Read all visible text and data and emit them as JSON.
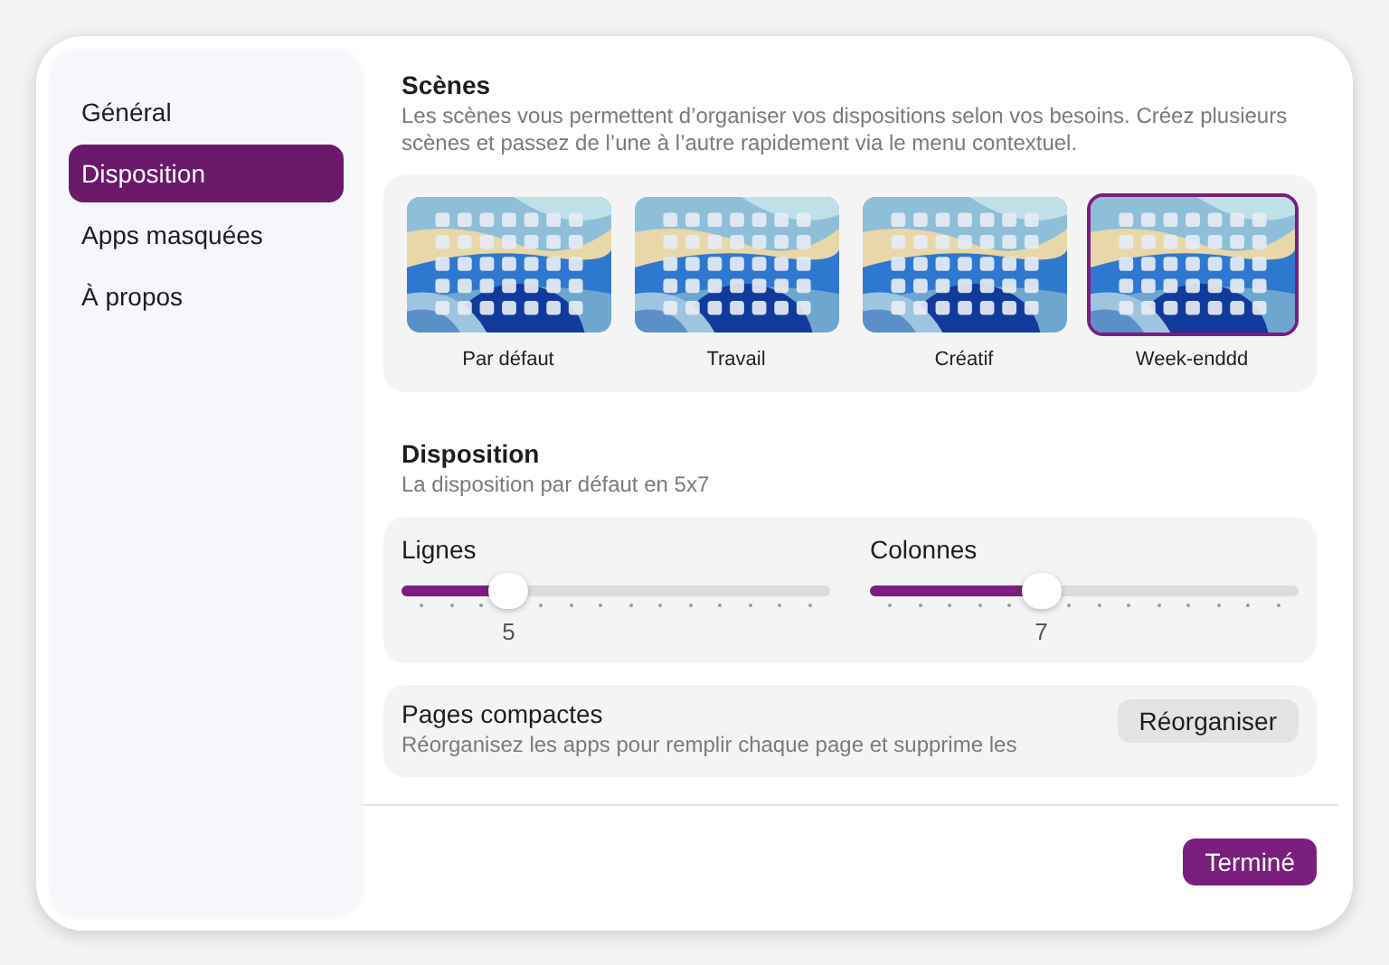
{
  "sidebar": {
    "items": [
      {
        "label": "Général",
        "selected": false
      },
      {
        "label": "Disposition",
        "selected": true
      },
      {
        "label": "Apps masquées",
        "selected": false
      },
      {
        "label": "À propos",
        "selected": false
      }
    ]
  },
  "scenes": {
    "title": "Scènes",
    "description": "Les scènes vous permettent d’organiser vos dispositions selon vos besoins. Créez plusieurs scènes et passez de l’une à l’autre rapidement via le menu contextuel.",
    "items": [
      {
        "label": "Par défaut",
        "selected": false
      },
      {
        "label": "Travail",
        "selected": false
      },
      {
        "label": "Créatif",
        "selected": false
      },
      {
        "label": "Week-enddd",
        "selected": true
      }
    ]
  },
  "layout": {
    "title": "Disposition",
    "description": "La disposition par défaut en 5x7",
    "sliders": [
      {
        "label": "Lignes",
        "level": 0.25,
        "reading": "5"
      },
      {
        "label": "Colonnes",
        "level": 0.4,
        "reading": "7"
      }
    ]
  },
  "compact": {
    "title": "Pages compactes",
    "description": "Réorganisez les apps pour remplir chaque page et supprime les",
    "button": "Réorganiser"
  },
  "footer": {
    "button": "Terminé"
  }
}
